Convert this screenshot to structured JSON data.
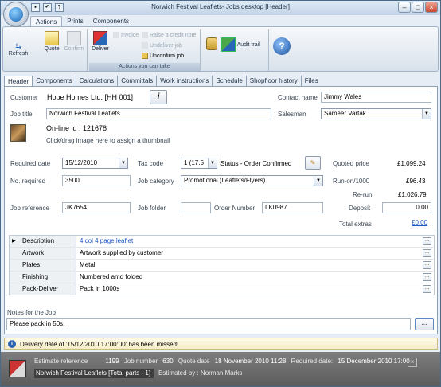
{
  "window": {
    "title": "Norwich Festival Leaflets- Jobs desktop [Header]"
  },
  "quick_access": [
    "save-icon",
    "undo-icon",
    "help-icon"
  ],
  "ribbon": {
    "tabs": [
      "Actions",
      "Prints",
      "Components"
    ],
    "active_tab": "Actions",
    "refresh_label": "Refresh",
    "quote_label": "Quote",
    "confirm_label": "Confirm",
    "deliver_label": "Deliver",
    "invoice_label": "Invoice",
    "raise_credit_label": "Raise a credit note",
    "undeliver_label": "Undeliver job",
    "unconfirm_label": "Unconfirm job",
    "group_caption": "Actions you can take",
    "audit_label": "Audit trail"
  },
  "page_tabs": [
    "Header",
    "Components",
    "Calculations",
    "Committals",
    "Work instructions",
    "Schedule",
    "Shopfloor history",
    "Files"
  ],
  "form": {
    "customer_label": "Customer",
    "customer_value": "Hope Homes Ltd. [HH 001]",
    "contact_label": "Contact name",
    "contact_value": "Jimmy Wales",
    "job_title_label": "Job title",
    "job_title_value": "Norwich Festival Leaflets",
    "salesman_label": "Salesman",
    "salesman_value": "Sameer Vartak",
    "online_id": "On-line id : 121678",
    "thumbnail_hint": "Click/drag image here to assign a thumbnail",
    "required_date_label": "Required date",
    "required_date_value": "15/12/2010",
    "tax_code_label": "Tax code",
    "tax_code_value": "1 (17.5",
    "status_text": "Status - Order Confirmed",
    "quoted_price_label": "Quoted price",
    "quoted_price_value": "£1,099.24",
    "no_required_label": "No. required",
    "no_required_value": "3500",
    "job_category_label": "Job category",
    "job_category_value": "Promotional (Leaflets/Flyers)",
    "runon_label": "Run-on/1000",
    "runon_value": "£96.43",
    "rerun_label": "Re-run",
    "rerun_value": "£1,026.79",
    "job_reference_label": "Job reference",
    "job_reference_value": "JK7654",
    "job_folder_label": "Job folder",
    "job_folder_value": "",
    "order_number_label": "Order Number",
    "order_number_value": "LK0987",
    "deposit_label": "Deposit",
    "deposit_value": "0.00",
    "total_extras_label": "Total extras",
    "total_extras_value": "£0.00"
  },
  "specs": [
    {
      "label": "Description",
      "value": "4 col 4 page leaflet"
    },
    {
      "label": "Artwork",
      "value": "Artwork supplied by customer"
    },
    {
      "label": "Plates",
      "value": "Metal"
    },
    {
      "label": "Finishing",
      "value": "Numbered amd folded"
    },
    {
      "label": "Pack-Deliver",
      "value": "Pack in 1000s"
    }
  ],
  "notes": {
    "label": "Notes for the Job",
    "value": "Please pack in  50s."
  },
  "info_message": "Delivery date of '15/12/2010 17:00:00' has been missed!",
  "statusbar": {
    "estimate_ref_label": "Estimate reference",
    "estimate_ref_value": "1199",
    "job_number_label": "Job number",
    "job_number_value": "630",
    "quote_date_label": "Quote date",
    "quote_date_value": "18 November 2010 11:28",
    "required_date_label": "Required date:",
    "required_date_value": "15 December 2010 17:00",
    "job_summary": "Norwich Festival Leaflets [Total parts - 1]",
    "estimated_by": "Estimated by : Norman Marks"
  }
}
